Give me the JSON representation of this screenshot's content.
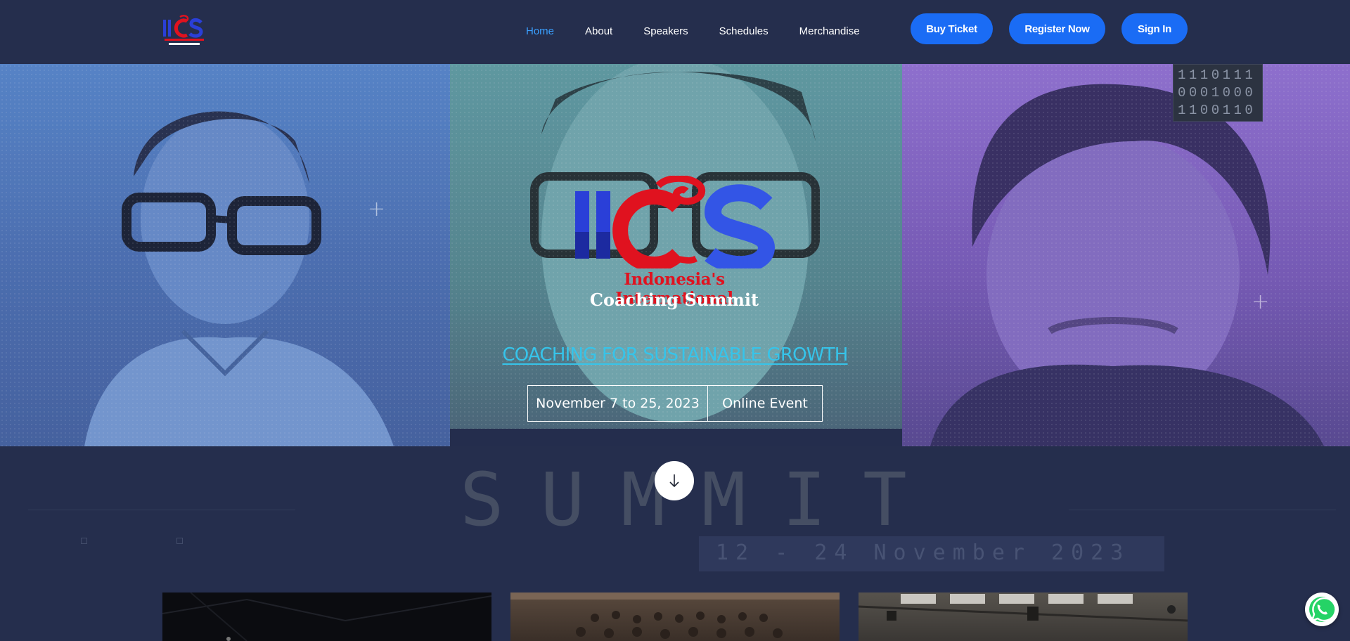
{
  "brand": {
    "logo_initials": "IICS",
    "logo_line1": "Indonesia's International",
    "logo_line2": "Coaching Summit"
  },
  "nav": {
    "links": [
      {
        "label": "Home",
        "active": true
      },
      {
        "label": "About",
        "active": false
      },
      {
        "label": "Speakers",
        "active": false
      },
      {
        "label": "Schedules",
        "active": false
      },
      {
        "label": "Merchandise",
        "active": false
      }
    ],
    "buttons": {
      "buy_ticket": "Buy Ticket",
      "register": "Register Now",
      "sign_in": "Sign In"
    }
  },
  "hero": {
    "binary_lines": [
      "1110111",
      "0001000",
      "1100110"
    ],
    "subtitle": "COACHING FOR SUSTAINABLE GROWTH",
    "event_date": "November 7 to 25, 2023",
    "event_type": "Online Event"
  },
  "lower": {
    "background_word": "SUMMIT",
    "ghost_date": "12 - 24 November 2023"
  },
  "icons": {
    "scroll": "arrow-down-icon",
    "whatsapp": "whatsapp-icon"
  },
  "colors": {
    "background": "#252e4d",
    "accent_blue": "#1a6cf5",
    "active_link": "#3aa0ff",
    "subtitle": "#36c4ea",
    "logo_red": "#e0121f",
    "logo_blue": "#2a3fd8"
  }
}
